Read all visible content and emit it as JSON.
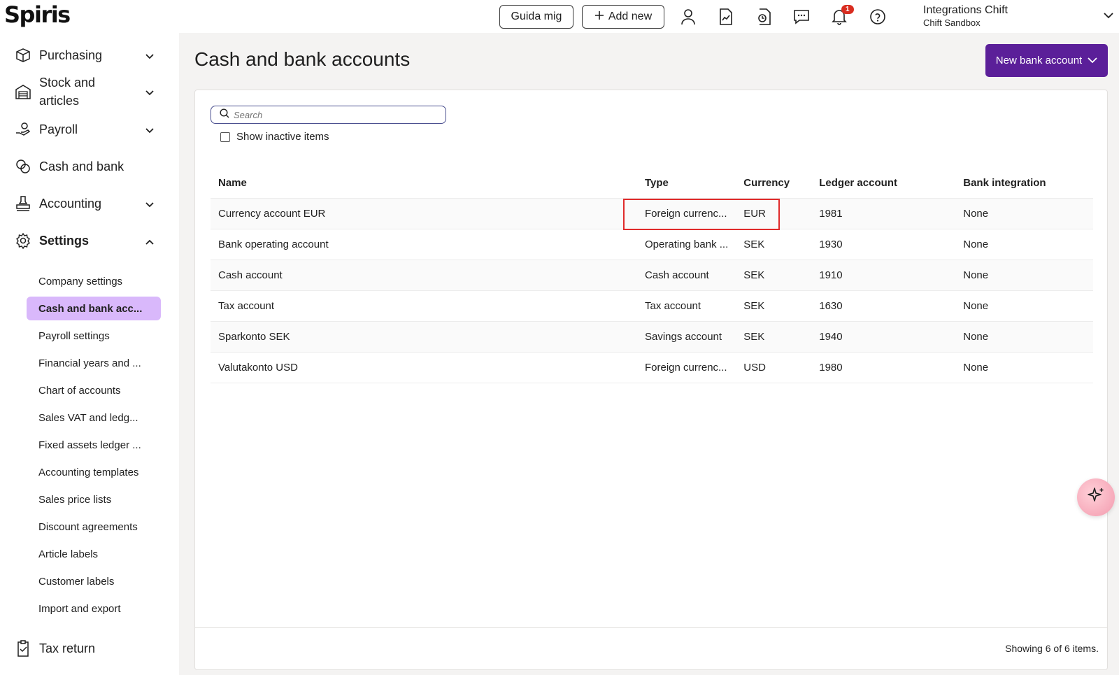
{
  "app": {
    "logo": "Spiris"
  },
  "topbar": {
    "guide_label": "Guida mig",
    "add_new_label": "Add new",
    "notification_count": "1",
    "org_name": "Integrations Chift",
    "org_sub": "Chift Sandbox",
    "icons": [
      "user-icon",
      "report-icon",
      "document-refresh-icon",
      "chat-icon",
      "bell-icon",
      "help-icon"
    ]
  },
  "sidebar": {
    "items": [
      {
        "label": "Purchasing",
        "icon": "box-icon",
        "expandable": true
      },
      {
        "label": "Stock and articles",
        "icon": "warehouse-icon",
        "expandable": true
      },
      {
        "label": "Payroll",
        "icon": "hand-money-icon",
        "expandable": true
      },
      {
        "label": "Cash and bank",
        "icon": "coins-icon",
        "expandable": false
      },
      {
        "label": "Accounting",
        "icon": "stamp-icon",
        "expandable": true
      },
      {
        "label": "Settings",
        "icon": "gear-icon",
        "expandable": true,
        "expanded": true
      },
      {
        "label": "Tax return",
        "icon": "clipboard-check-icon",
        "expandable": false
      }
    ],
    "settings_items": [
      "Company settings",
      "Cash and bank acc...",
      "Payroll settings",
      "Financial years and ...",
      "Chart of accounts",
      "Sales VAT and ledg...",
      "Fixed assets ledger ...",
      "Accounting templates",
      "Sales price lists",
      "Discount agreements",
      "Article labels",
      "Customer labels",
      "Import and export"
    ],
    "active_settings_index": 1
  },
  "page": {
    "title": "Cash and bank accounts",
    "new_button_label": "New bank account",
    "search_placeholder": "Search",
    "show_inactive_label": "Show inactive items",
    "footer_text": "Showing 6 of 6 items."
  },
  "table": {
    "columns": [
      "Name",
      "Type",
      "Currency",
      "Ledger account",
      "Bank integration"
    ],
    "rows": [
      [
        "Currency account EUR",
        "Foreign currenc...",
        "EUR",
        "1981",
        "None"
      ],
      [
        "Bank operating account",
        "Operating bank ...",
        "SEK",
        "1930",
        "None"
      ],
      [
        "Cash account",
        "Cash account",
        "SEK",
        "1910",
        "None"
      ],
      [
        "Tax account",
        "Tax account",
        "SEK",
        "1630",
        "None"
      ],
      [
        "Sparkonto SEK",
        "Savings account",
        "SEK",
        "1940",
        "None"
      ],
      [
        "Valutakonto USD",
        "Foreign currenc...",
        "USD",
        "1980",
        "None"
      ]
    ]
  },
  "colors": {
    "accent": "#5b1f99",
    "active_nav": "#d9b8fb",
    "highlight": "#e02b2b",
    "badge": "#d92d20"
  }
}
